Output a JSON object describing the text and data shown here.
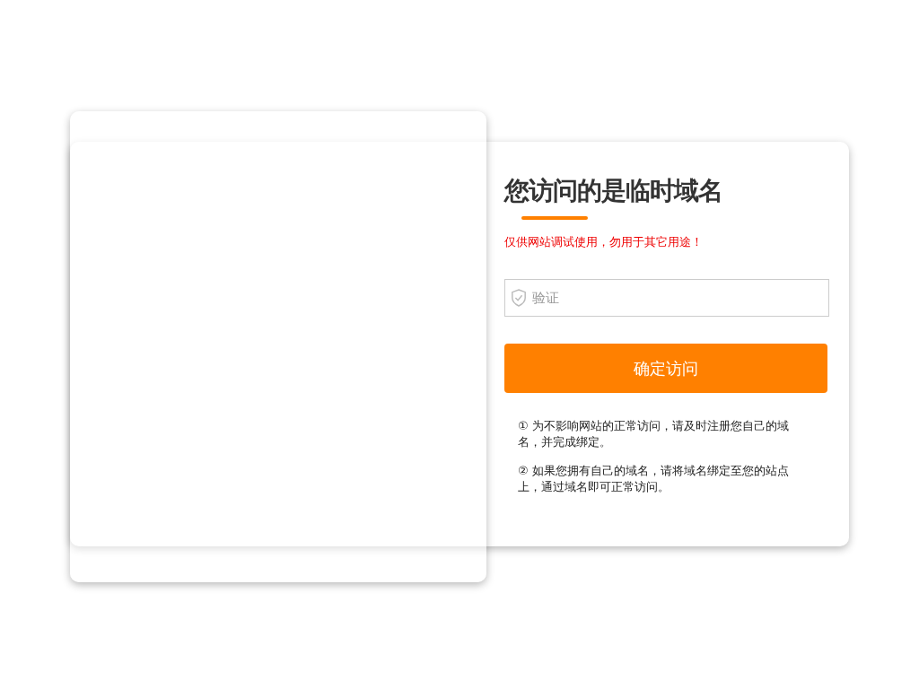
{
  "dialog": {
    "title": "您访问的是临时域名",
    "warning": "仅供网站调试使用，勿用于其它用途！",
    "verify_field": {
      "placeholder": "验证"
    },
    "submit_button": "确定访问",
    "notes": [
      "① 为不影响网站的正常访问，请及时注册您自己的域名，并完成绑定。",
      "② 如果您拥有自己的域名，请将域名绑定至您的站点上，通过域名即可正常访问。"
    ]
  }
}
